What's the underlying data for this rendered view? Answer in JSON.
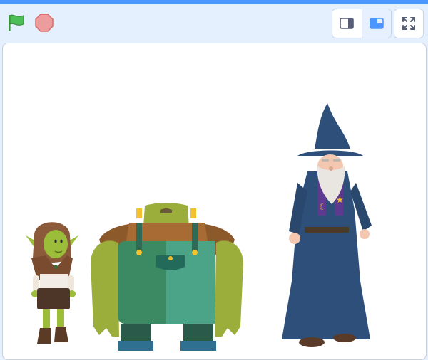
{
  "controls": {
    "green_flag_icon": "green-flag-icon",
    "stop_icon": "stop-octagon-icon",
    "small_stage_icon": "small-stage-mode-icon",
    "large_stage_icon": "large-stage-mode-icon",
    "fullscreen_icon": "fullscreen-icon"
  },
  "stage": {
    "sprites": [
      "goblin",
      "ogre",
      "wizard"
    ]
  },
  "colors": {
    "accent": "#4c97ff",
    "background": "#e5f0ff",
    "flag_green": "#4cbf56",
    "stop_red": "#ec9c9c"
  }
}
